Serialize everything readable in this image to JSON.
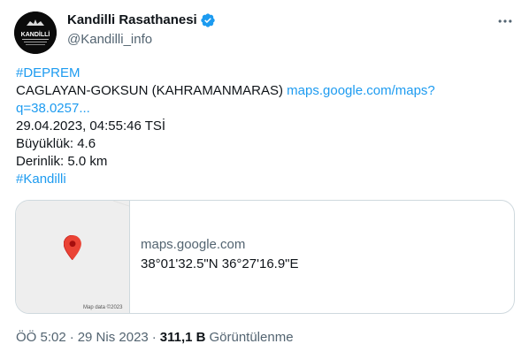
{
  "author": {
    "display_name": "Kandilli Rasathanesi",
    "handle": "@Kandilli_info",
    "avatar_text": "KANDİLLİ",
    "avatar_subtext": "RASATHANESİ VE DEPREM ARAŞTIRMA ENSTİTÜSÜ"
  },
  "tweet": {
    "hashtag_1": "#DEPREM",
    "location": "CAGLAYAN-GOKSUN (KAHRAMANMARAS)",
    "map_link_1": "maps.google.com/maps?",
    "map_link_2": "q=38.0257...",
    "datetime": "29.04.2023, 04:55:46 TSİ",
    "magnitude": "Büyüklük: 4.6",
    "depth": "Derinlik: 5.0 km",
    "hashtag_2": "#Kandilli"
  },
  "card": {
    "domain": "maps.google.com",
    "coordinates": "38°01'32.5\"N 36°27'16.9\"E",
    "map_credit": "Map data ©2023"
  },
  "meta": {
    "time": "ÖÖ 5:02",
    "date": "29 Nis 2023",
    "separator": "·",
    "views_count": "311,1 B",
    "views_label": "Görüntülenme"
  },
  "colors": {
    "link": "#1d9bf0",
    "verified": "#1d9bf0",
    "secondary_text": "#536471",
    "map_pin": "#ea4335"
  },
  "icons": [
    "verified-badge-icon",
    "more-options-icon",
    "map-pin-icon"
  ]
}
